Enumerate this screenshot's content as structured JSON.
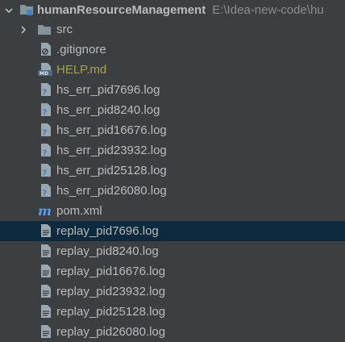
{
  "project": {
    "name": "humanResourceManagement",
    "path": "E:\\Idea-new-code\\hu"
  },
  "items": [
    {
      "label": "src",
      "icon": "folder-icon",
      "type": "folder"
    },
    {
      "label": ".gitignore",
      "icon": "ignored-file-icon",
      "type": "file"
    },
    {
      "label": "HELP.md",
      "icon": "markdown-file-icon",
      "type": "markdown"
    },
    {
      "label": "hs_err_pid7696.log",
      "icon": "unknown-file-icon",
      "type": "file"
    },
    {
      "label": "hs_err_pid8240.log",
      "icon": "unknown-file-icon",
      "type": "file"
    },
    {
      "label": "hs_err_pid16676.log",
      "icon": "unknown-file-icon",
      "type": "file"
    },
    {
      "label": "hs_err_pid23932.log",
      "icon": "unknown-file-icon",
      "type": "file"
    },
    {
      "label": "hs_err_pid25128.log",
      "icon": "unknown-file-icon",
      "type": "file"
    },
    {
      "label": "hs_err_pid26080.log",
      "icon": "unknown-file-icon",
      "type": "file"
    },
    {
      "label": "pom.xml",
      "icon": "maven-icon",
      "type": "file"
    },
    {
      "label": "replay_pid7696.log",
      "icon": "text-file-icon",
      "type": "file",
      "selected": true
    },
    {
      "label": "replay_pid8240.log",
      "icon": "text-file-icon",
      "type": "file"
    },
    {
      "label": "replay_pid16676.log",
      "icon": "text-file-icon",
      "type": "file"
    },
    {
      "label": "replay_pid23932.log",
      "icon": "text-file-icon",
      "type": "file"
    },
    {
      "label": "replay_pid25128.log",
      "icon": "text-file-icon",
      "type": "file"
    },
    {
      "label": "replay_pid26080.log",
      "icon": "text-file-icon",
      "type": "file"
    }
  ],
  "colors": {
    "background": "#3c3f41",
    "selection": "#0d293e",
    "text": "#bbbbbb",
    "markdown_text": "#a4a24a",
    "path_text": "#8c8c8c",
    "folder": "#87939a",
    "maven": "#5c9ce6"
  }
}
